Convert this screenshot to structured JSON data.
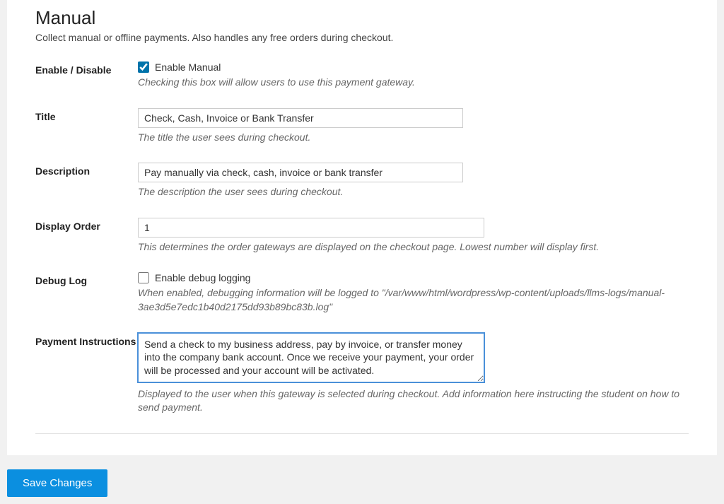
{
  "header": {
    "title": "Manual",
    "subtitle": "Collect manual or offline payments. Also handles any free orders during checkout."
  },
  "fields": {
    "enable": {
      "label": "Enable / Disable",
      "checkbox_label": "Enable Manual",
      "help": "Checking this box will allow users to use this payment gateway."
    },
    "title": {
      "label": "Title",
      "value": "Check, Cash, Invoice or Bank Transfer",
      "help": "The title the user sees during checkout."
    },
    "description": {
      "label": "Description",
      "value": "Pay manually via check, cash, invoice or bank transfer",
      "help": "The description the user sees during checkout."
    },
    "display_order": {
      "label": "Display Order",
      "value": "1",
      "help": "This determines the order gateways are displayed on the checkout page. Lowest number will display first."
    },
    "debug_log": {
      "label": "Debug Log",
      "checkbox_label": "Enable debug logging",
      "help": "When enabled, debugging information will be logged to \"/var/www/html/wordpress/wp-content/uploads/llms-logs/manual-3ae3d5e7edc1b40d2175dd93b89bc83b.log\""
    },
    "payment_instructions": {
      "label": "Payment Instructions",
      "value": "Send a check to my business address, pay by invoice, or transfer money into the company bank account. Once we receive your payment, your order will be processed and your account will be activated.",
      "help": "Displayed to the user when this gateway is selected during checkout. Add information here instructing the student on how to send payment."
    }
  },
  "actions": {
    "save_label": "Save Changes"
  }
}
